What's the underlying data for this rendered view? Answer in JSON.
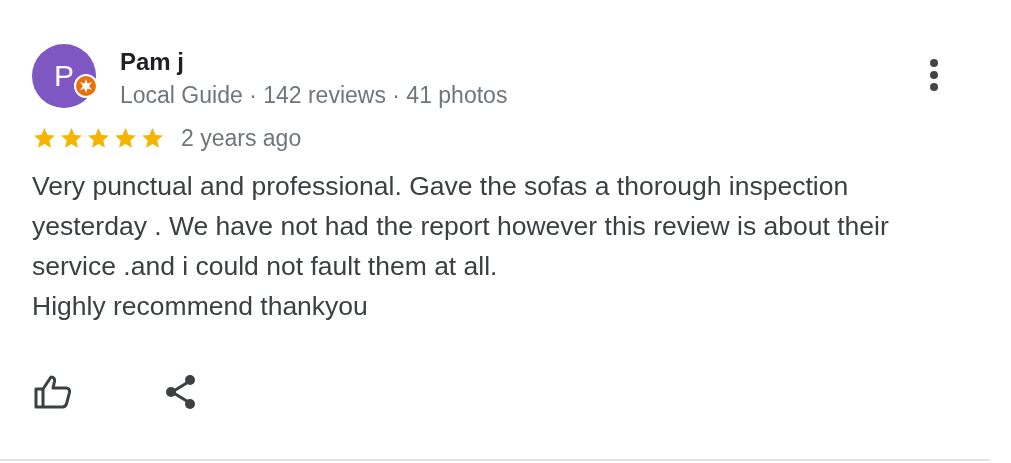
{
  "review": {
    "avatar_letter": "P",
    "name": "Pam j",
    "meta": "Local Guide · 142 reviews · 41 photos",
    "stars": 5,
    "time": "2 years ago",
    "paragraphs": [
      "Very punctual and professional. Gave the sofas a thorough inspection yesterday . We have not had the report however this review is about their service .and i could not fault them at all.",
      "Highly recommend thankyou"
    ]
  }
}
